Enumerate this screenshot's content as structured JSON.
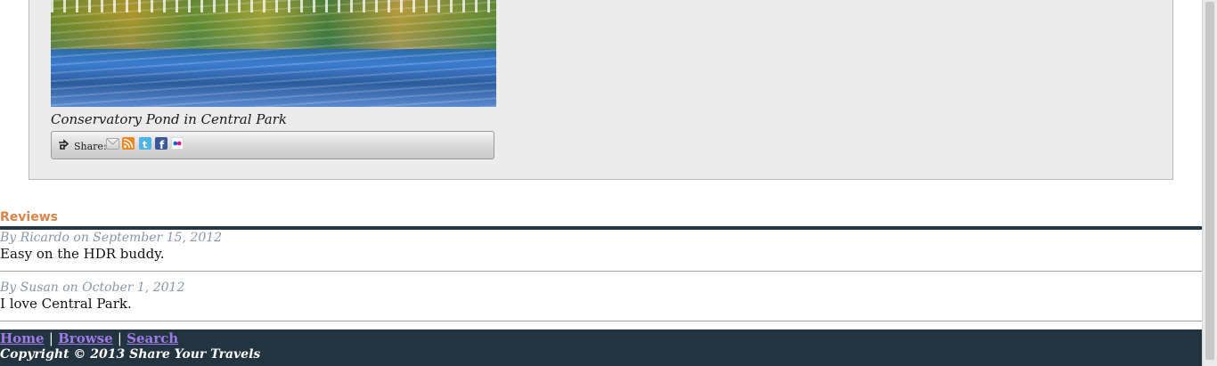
{
  "photo": {
    "caption": "Conservatory Pond in Central Park"
  },
  "share": {
    "label": "Share:",
    "icons": [
      "email-icon",
      "rss-icon",
      "twitter-icon",
      "facebook-icon",
      "flickr-icon"
    ]
  },
  "reviews": {
    "title": "Reviews",
    "items": [
      {
        "meta": "By Ricardo on September 15, 2012",
        "text": "Easy on the HDR buddy."
      },
      {
        "meta": "By Susan on October 1, 2012",
        "text": "I love Central Park."
      }
    ]
  },
  "footer": {
    "links": [
      "Home",
      "Browse",
      "Search"
    ],
    "separator": "|",
    "copyright": "Copyright © 2013 Share Your Travels"
  },
  "colors": {
    "accent": "#d8844a",
    "footer_bg": "#22343f",
    "link": "#9f7bea",
    "meta_text": "#8a96a2"
  }
}
